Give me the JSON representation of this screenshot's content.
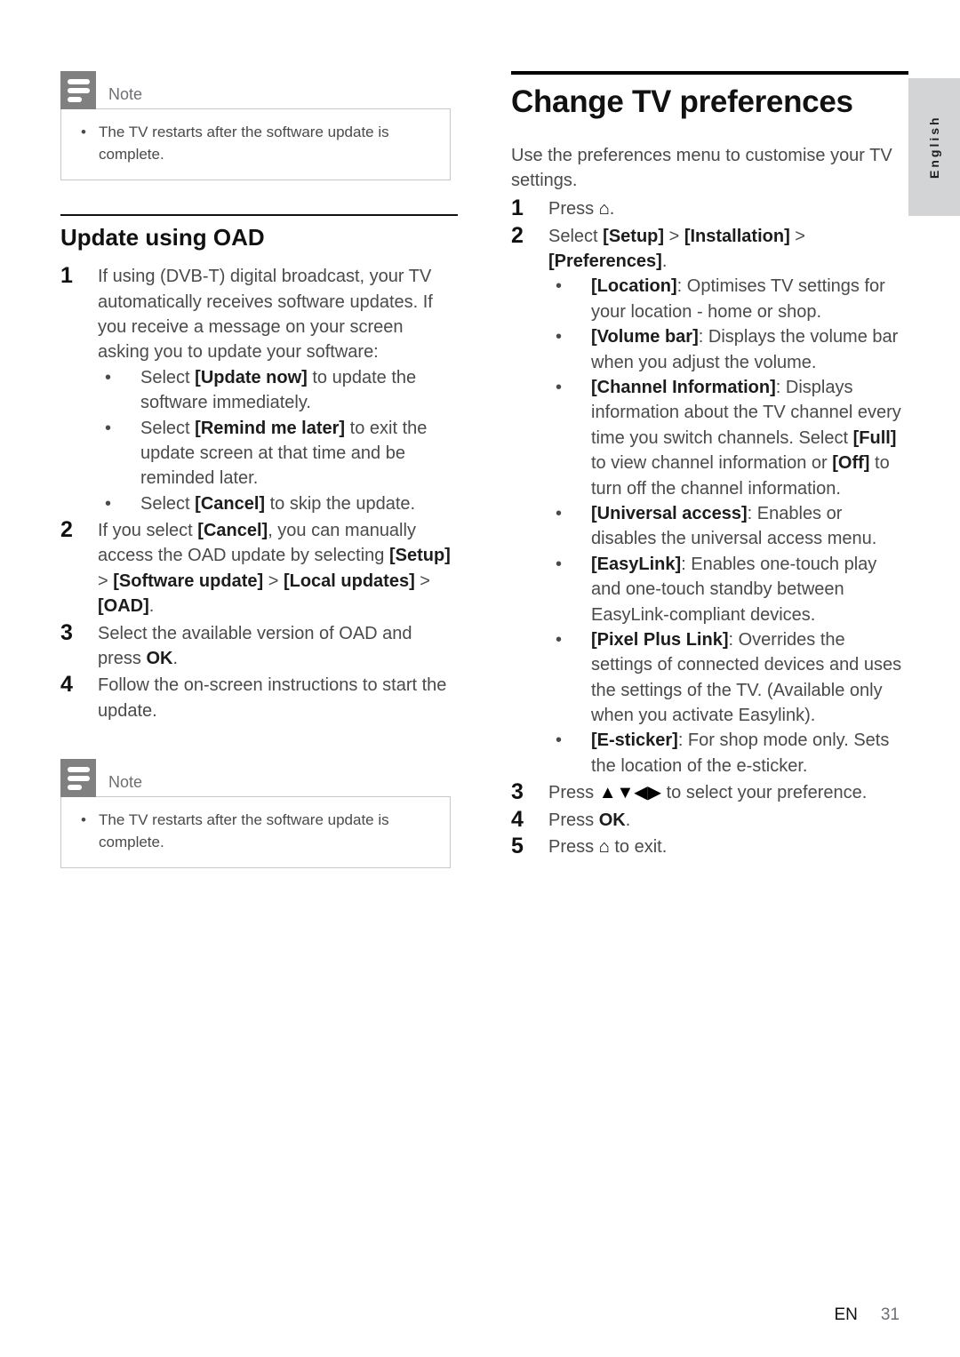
{
  "language_tab": {
    "label": "English"
  },
  "left_column": {
    "note_top": {
      "icon": "note-icon",
      "title": "Note",
      "items": [
        "The TV restarts after the software update is complete."
      ]
    },
    "section": {
      "heading": "Update using OAD",
      "steps": [
        {
          "number": "1",
          "text": "If using (DVB-T) digital broadcast, your TV automatically receives software updates. If you receive a message on your screen asking you to update your software:",
          "bullets": [
            {
              "lead": "Select ",
              "bold": "[Update now]",
              "tail": " to update the software immediately."
            },
            {
              "lead": "Select ",
              "bold": "[Remind me later]",
              "tail": " to exit the update screen at that time and be reminded later."
            },
            {
              "lead": "Select ",
              "bold": "[Cancel]",
              "tail": " to skip the update."
            }
          ]
        },
        {
          "number": "2",
          "parts": [
            {
              "t": "If you select ",
              "b": false
            },
            {
              "t": "[Cancel]",
              "b": true
            },
            {
              "t": ", you can manually access the OAD update by selecting ",
              "b": false
            },
            {
              "t": "[Setup]",
              "b": true
            },
            {
              "t": " > ",
              "b": false
            },
            {
              "t": "[Software update]",
              "b": true
            },
            {
              "t": " > ",
              "b": false
            },
            {
              "t": "[Local updates]",
              "b": true
            },
            {
              "t": " > ",
              "b": false
            },
            {
              "t": "[OAD]",
              "b": true
            },
            {
              "t": ".",
              "b": false
            }
          ]
        },
        {
          "number": "3",
          "parts": [
            {
              "t": "Select the available version of OAD and press ",
              "b": false
            },
            {
              "t": "OK",
              "b": true
            },
            {
              "t": ".",
              "b": false
            }
          ]
        },
        {
          "number": "4",
          "parts": [
            {
              "t": "Follow the on-screen instructions to start the update.",
              "b": false
            }
          ]
        }
      ]
    },
    "note_bottom": {
      "icon": "note-icon",
      "title": "Note",
      "items": [
        "The TV restarts after the software update is complete."
      ]
    }
  },
  "right_column": {
    "heading": "Change TV preferences",
    "intro": "Use the preferences menu to customise your TV settings.",
    "steps_top": [
      {
        "number": "1",
        "parts": [
          {
            "t": "Press ",
            "b": false
          },
          {
            "t": "⌂",
            "b": false,
            "icon": "home-icon"
          },
          {
            "t": ".",
            "b": false
          }
        ]
      },
      {
        "number": "2",
        "parts": [
          {
            "t": "Select ",
            "b": false
          },
          {
            "t": "[Setup]",
            "b": true
          },
          {
            "t": " > ",
            "b": false
          },
          {
            "t": "[Installation]",
            "b": true
          },
          {
            "t": " > ",
            "b": false
          },
          {
            "t": "[Preferences]",
            "b": true
          },
          {
            "t": ".",
            "b": false
          }
        ]
      }
    ],
    "preference_bullets": [
      {
        "bold": "[Location]",
        "tail": ": Optimises TV settings for your location - home or shop."
      },
      {
        "bold": "[Volume bar]",
        "tail": ": Displays the volume bar when you adjust the volume."
      },
      {
        "bold": "[Channel Information]",
        "tail": ": Displays information about the TV channel every time you switch channels. Select ",
        "bold2": "[Full]",
        "tail2": " to view channel information or ",
        "bold3": "[Off]",
        "tail3": " to turn off the channel information."
      },
      {
        "bold": "[Universal access]",
        "tail": ": Enables or disables the universal access menu."
      },
      {
        "bold": "[EasyLink]",
        "tail": ": Enables one-touch play and one-touch standby between EasyLink-compliant devices."
      },
      {
        "bold": "[Pixel Plus Link]",
        "tail": ": Overrides the settings of connected devices and uses the settings of the TV. (Available only when you activate Easylink)."
      },
      {
        "bold": "[E-sticker]",
        "tail": ": For shop mode only. Sets the location of the e-sticker."
      }
    ],
    "steps_bottom": [
      {
        "number": "3",
        "parts": [
          {
            "t": "Press ",
            "b": false
          },
          {
            "t": "▲▼◀▶",
            "b": false,
            "icon": "dpad-icon"
          },
          {
            "t": " to select your preference.",
            "b": false
          }
        ]
      },
      {
        "number": "4",
        "parts": [
          {
            "t": "Press ",
            "b": false
          },
          {
            "t": "OK",
            "b": true
          },
          {
            "t": ".",
            "b": false
          }
        ]
      },
      {
        "number": "5",
        "parts": [
          {
            "t": "Press ",
            "b": false
          },
          {
            "t": "⌂",
            "b": false,
            "icon": "home-icon"
          },
          {
            "t": " to exit.",
            "b": false
          }
        ]
      }
    ]
  },
  "footer": {
    "lang_code": "EN",
    "page_number": "31"
  }
}
